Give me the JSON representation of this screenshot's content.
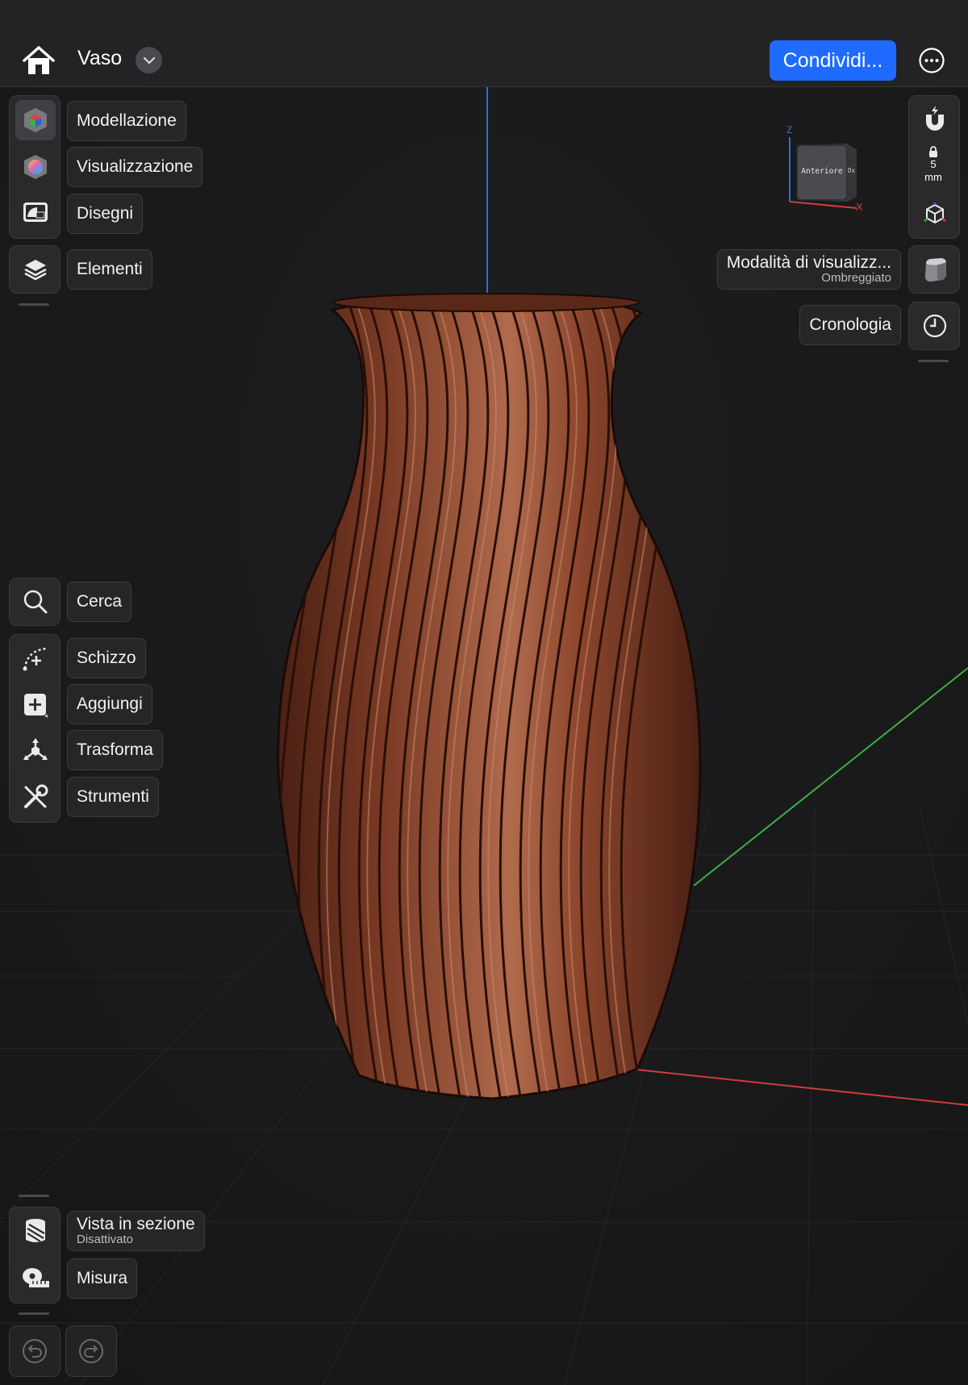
{
  "header": {
    "title": "Vaso",
    "share_label": "Condividi..."
  },
  "left_toolbar_top": [
    {
      "label": "Modellazione",
      "icon": "modeling-cube-icon"
    },
    {
      "label": "Visualizzazione",
      "icon": "visualization-color-icon"
    },
    {
      "label": "Disegni",
      "icon": "drawings-icon"
    },
    {
      "label": "Elementi",
      "icon": "layers-icon"
    }
  ],
  "left_toolbar_middle": [
    {
      "label": "Cerca",
      "icon": "search-icon"
    },
    {
      "label": "Schizzo",
      "icon": "sketch-icon"
    },
    {
      "label": "Aggiungi",
      "icon": "add-icon"
    },
    {
      "label": "Trasforma",
      "icon": "transform-icon"
    },
    {
      "label": "Strumenti",
      "icon": "tools-icon"
    }
  ],
  "left_toolbar_bottom": [
    {
      "label": "Vista in sezione",
      "sublabel": "Disattivato",
      "icon": "section-view-icon"
    },
    {
      "label": "Misura",
      "icon": "measure-icon"
    }
  ],
  "right_toolbar": {
    "snap_value": "5",
    "snap_unit": "mm",
    "view_mode_label": "Modalità di visualizz...",
    "view_mode_value": "Ombreggiato",
    "history_label": "Cronologia"
  },
  "view_cube": {
    "face_label": "Anteriore",
    "side_label": "Dx",
    "axis_z": "Z",
    "axis_x": "X"
  },
  "model": {
    "color": "#8a4630",
    "highlight": "#c07a5d"
  },
  "colors": {
    "accent": "#1f6bff",
    "axis_x": "#d23b3b",
    "axis_y": "#3cb043",
    "axis_z": "#2f6fd6"
  }
}
